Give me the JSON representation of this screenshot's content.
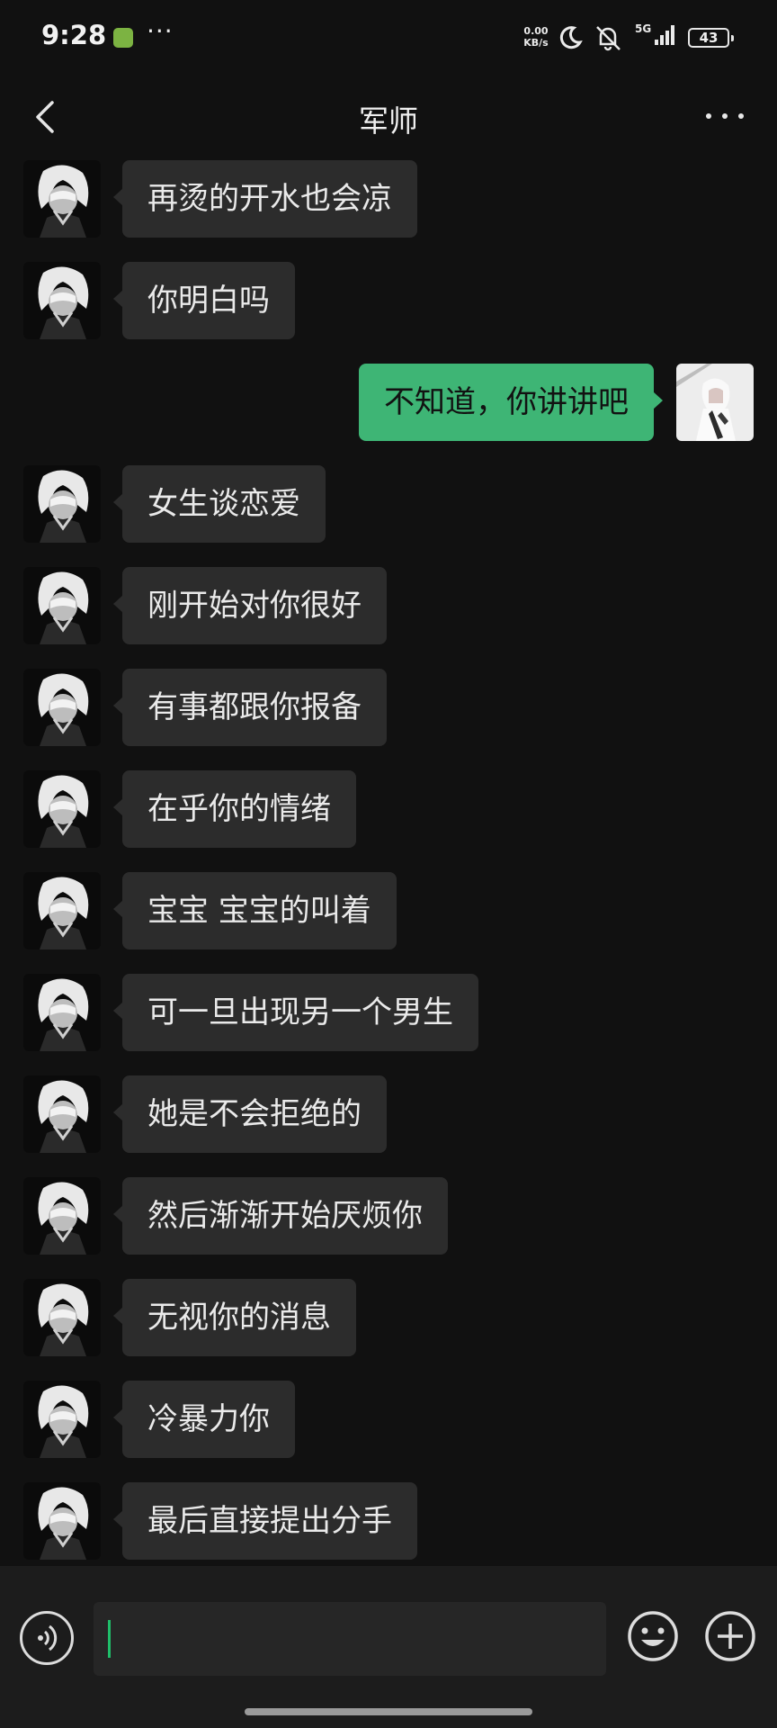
{
  "status_bar": {
    "time": "9:28",
    "notification_dots": "···",
    "net_speed_value": "0.00",
    "net_speed_unit": "KB/s",
    "network_type": "5G",
    "battery_level": "43"
  },
  "header": {
    "title": "军师"
  },
  "messages": [
    {
      "side": "in",
      "text": "再烫的开水也会凉"
    },
    {
      "side": "in",
      "text": "你明白吗"
    },
    {
      "side": "out",
      "text": "不知道，你讲讲吧"
    },
    {
      "side": "in",
      "text": "女生谈恋爱"
    },
    {
      "side": "in",
      "text": "刚开始对你很好"
    },
    {
      "side": "in",
      "text": "有事都跟你报备"
    },
    {
      "side": "in",
      "text": "在乎你的情绪"
    },
    {
      "side": "in",
      "text": "宝宝 宝宝的叫着"
    },
    {
      "side": "in",
      "text": "可一旦出现另一个男生"
    },
    {
      "side": "in",
      "text": "她是不会拒绝的"
    },
    {
      "side": "in",
      "text": "然后渐渐开始厌烦你"
    },
    {
      "side": "in",
      "text": "无视你的消息"
    },
    {
      "side": "in",
      "text": "冷暴力你"
    },
    {
      "side": "in",
      "text": "最后直接提出分手"
    }
  ],
  "input_bar": {
    "input_value": "",
    "icons": [
      "voice-icon",
      "emoji-icon",
      "plus-icon"
    ]
  },
  "colors": {
    "background": "#111111",
    "incoming_bubble": "#2c2c2c",
    "outgoing_bubble": "#3eb575",
    "cursor": "#1fbf6a"
  }
}
